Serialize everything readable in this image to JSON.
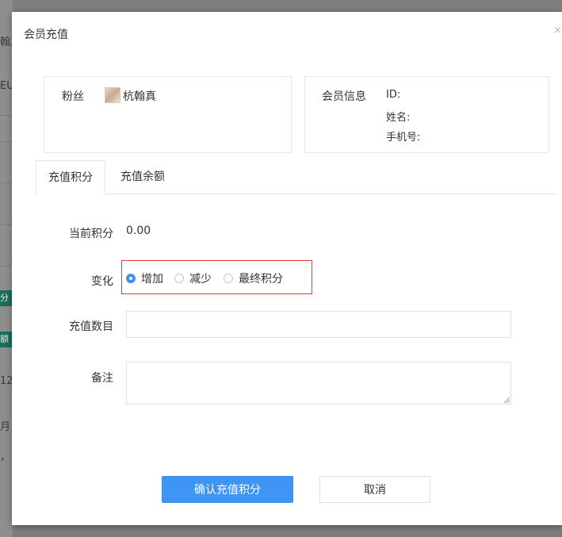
{
  "background": {
    "fragments": [
      "翰真",
      "EUI",
      "分演",
      "额消",
      "12",
      "月",
      "，"
    ]
  },
  "modal": {
    "title": "会员充值",
    "close_glyph": "×"
  },
  "fan_card": {
    "label": "粉丝",
    "name": "杭翰真"
  },
  "member_info": {
    "label": "会员信息",
    "id_label": "ID:",
    "name_label": "姓名:",
    "phone_label": "手机号:"
  },
  "tabs": [
    {
      "label": "充值积分",
      "active": true
    },
    {
      "label": "充值余额",
      "active": false
    }
  ],
  "form": {
    "current_points_label": "当前积分",
    "current_points_value": "0.00",
    "change_label": "变化",
    "change_options": [
      {
        "label": "增加",
        "checked": true
      },
      {
        "label": "减少",
        "checked": false
      },
      {
        "label": "最终积分",
        "checked": false
      }
    ],
    "amount_label": "充值数目",
    "amount_value": "",
    "note_label": "备注",
    "note_value": ""
  },
  "buttons": {
    "confirm": "确认充值积分",
    "cancel": "取消"
  },
  "colors": {
    "primary": "#3f95f4",
    "highlight_border": "#e03c31",
    "radio_checked": "#3e8ff2"
  }
}
